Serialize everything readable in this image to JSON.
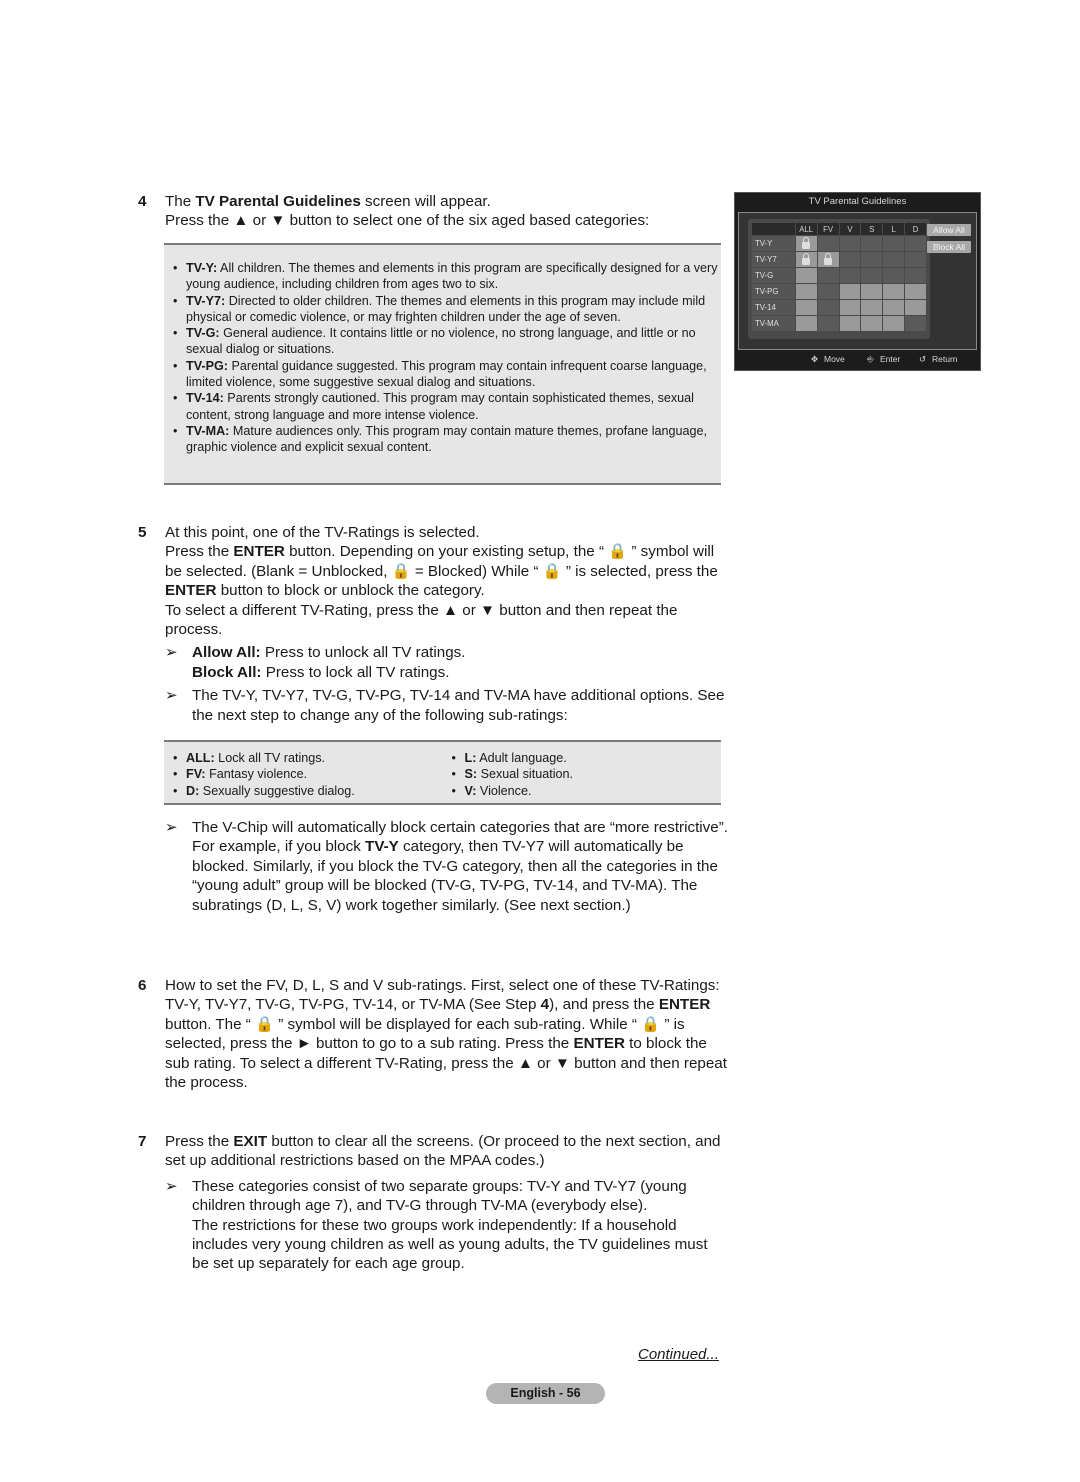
{
  "step4": {
    "number": "4",
    "line1_pre": "The ",
    "line1_bold": "TV Parental Guidelines",
    "line1_post": " screen will appear.",
    "line2": "Press the ▲ or ▼ button to select one of the six aged based categories:",
    "ratings": [
      {
        "code": "TV-Y:",
        "text": " All children. The themes and elements in this program are specifically designed for a very young audience, including children from ages two to six."
      },
      {
        "code": "TV-Y7:",
        "text": " Directed to older children. The themes and elements in this program may include mild physical or comedic violence, or may frighten children under the age of seven."
      },
      {
        "code": "TV-G:",
        "text": " General audience. It contains little or no violence, no strong language, and little or no sexual dialog or situations."
      },
      {
        "code": "TV-PG:",
        "text": " Parental guidance suggested. This program may contain infrequent coarse language, limited violence, some suggestive sexual dialog and situations."
      },
      {
        "code": "TV-14:",
        "text": " Parents strongly cautioned. This program may contain sophisticated themes, sexual content, strong language and more intense violence."
      },
      {
        "code": "TV-MA:",
        "text": " Mature audiences only. This program may contain mature themes, profane language, graphic violence and explicit sexual content."
      }
    ]
  },
  "tv_screen": {
    "title": "TV Parental Guidelines",
    "columns": [
      "ALL",
      "FV",
      "V",
      "S",
      "L",
      "D"
    ],
    "rows": [
      {
        "label": "TV-Y",
        "cells": [
          "lock",
          "n/a",
          "n/a",
          "n/a",
          "n/a",
          "n/a"
        ]
      },
      {
        "label": "TV-Y7",
        "cells": [
          "lock",
          "lock",
          "n/a",
          "n/a",
          "n/a",
          "n/a"
        ]
      },
      {
        "label": "TV-G",
        "cells": [
          "open",
          "n/a",
          "n/a",
          "n/a",
          "n/a",
          "n/a"
        ]
      },
      {
        "label": "TV-PG",
        "cells": [
          "open",
          "n/a",
          "open",
          "open",
          "open",
          "open"
        ]
      },
      {
        "label": "TV-14",
        "cells": [
          "open",
          "n/a",
          "open",
          "open",
          "open",
          "open"
        ]
      },
      {
        "label": "TV-MA",
        "cells": [
          "open",
          "n/a",
          "open",
          "open",
          "open",
          "n/a"
        ]
      }
    ],
    "allow_all": "Allow All",
    "block_all": "Block All",
    "footer": {
      "move": "Move",
      "enter": "Enter",
      "return": "Return"
    }
  },
  "step5": {
    "number": "5",
    "line1": "At this point, one of the TV-Ratings is selected.",
    "p2_a": "Press the ",
    "p2_b": "ENTER",
    "p2_c": " button. Depending on your existing setup, the “ ",
    "p2_d": " ” symbol will be selected. (Blank = Unblocked, ",
    "p2_e": " = Blocked) While “ ",
    "p2_f": " ” is selected, press the ",
    "p2_g": "ENTER",
    "p2_h": " button to block or unblock the category.",
    "p3": "To select a different TV-Rating, press the ▲ or ▼ button and then repeat the process.",
    "note1_allow_bold": "Allow All:",
    "note1_allow_text": " Press to unlock all TV ratings.",
    "note1_block_bold": "Block All:",
    "note1_block_text": " Press to lock all TV ratings.",
    "note2": "The TV-Y, TV-Y7, TV-G, TV-PG, TV-14 and TV-MA have additional options. See the next step to change any of the following sub-ratings:",
    "subratings_left": [
      {
        "code": "ALL:",
        "text": " Lock all TV ratings."
      },
      {
        "code": "FV:",
        "text": " Fantasy violence."
      },
      {
        "code": "D:",
        "text": " Sexually suggestive dialog."
      }
    ],
    "subratings_right": [
      {
        "code": "L:",
        "text": " Adult language."
      },
      {
        "code": "S:",
        "text": " Sexual situation."
      },
      {
        "code": "V:",
        "text": " Violence."
      }
    ],
    "note3_a": "The V-Chip will automatically block certain categories that are “more restrictive”. For example, if you block ",
    "note3_b": "TV-Y",
    "note3_c": " category, then TV-Y7 will automatically be blocked. Similarly, if you block the TV-G category, then all the categories in the “young adult” group will be blocked (TV-G, TV-PG, TV-14, and TV-MA). The subratings (D, L, S, V) work together similarly. (See next section.)"
  },
  "step6": {
    "number": "6",
    "a": "How to set the FV, D, L, S and V sub-ratings. First, select one of these TV-Ratings: TV-Y, TV-Y7, TV-G, TV-PG, TV-14, or TV-MA (See Step ",
    "b": "4",
    "c": "), and press the ",
    "d": "ENTER",
    "e": " button. The “ ",
    "f": " ” symbol will be displayed for each sub-rating. While “ ",
    "g": " ” is selected, press the ► button to go to a sub rating. Press the ",
    "h": "ENTER",
    "i": " to block the sub rating. To select a different TV-Rating, press the ▲ or ▼ button and then repeat the process."
  },
  "step7": {
    "number": "7",
    "a": "Press the ",
    "b": "EXIT",
    "c": " button to clear all the screens. (Or proceed to the next section, and set up additional restrictions based on the MPAA codes.)",
    "note_1": "These categories consist of two separate groups: TV-Y and TV-Y7 (young children through age 7), and TV-G through TV-MA (everybody else).",
    "note_2": "The restrictions for these two groups work independently: If a household includes very young children as well as young adults, the TV guidelines must be set up separately for each age group."
  },
  "arrow_glyph": "➢",
  "bullet_glyph": "•",
  "continued": "Continued...",
  "page_label": "English - 56"
}
